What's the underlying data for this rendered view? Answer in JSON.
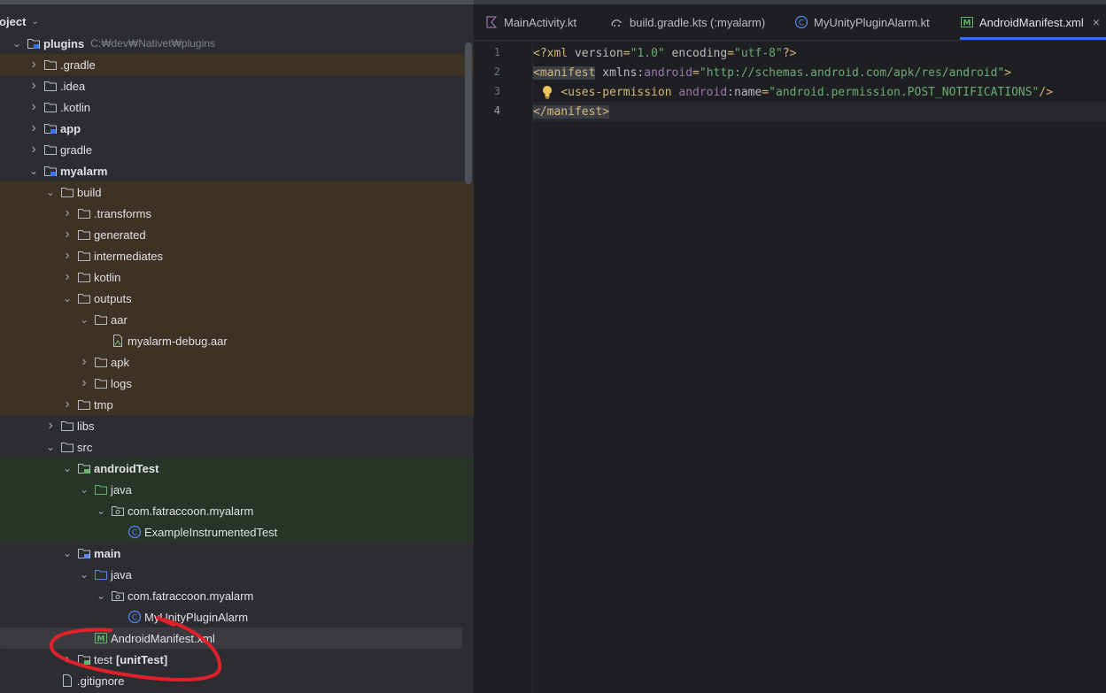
{
  "project_panel": {
    "title": "roject",
    "tree": [
      {
        "label": "plugins",
        "path": "C:₩dev₩Nativet₩plugins",
        "depth": 0,
        "arrow": "down",
        "icon": "module-folder-icon",
        "bold": true,
        "hl": ""
      },
      {
        "label": ".gradle",
        "depth": 1,
        "arrow": "right",
        "icon": "folder-icon",
        "hl": "brown"
      },
      {
        "label": ".idea",
        "depth": 1,
        "arrow": "right",
        "icon": "folder-icon",
        "hl": ""
      },
      {
        "label": ".kotlin",
        "depth": 1,
        "arrow": "right",
        "icon": "folder-icon",
        "hl": ""
      },
      {
        "label": "app",
        "depth": 1,
        "arrow": "right",
        "icon": "module-folder-icon",
        "bold": true,
        "hl": ""
      },
      {
        "label": "gradle",
        "depth": 1,
        "arrow": "right",
        "icon": "folder-icon",
        "hl": ""
      },
      {
        "label": "myalarm",
        "depth": 1,
        "arrow": "down",
        "icon": "module-folder-icon",
        "bold": true,
        "hl": ""
      },
      {
        "label": "build",
        "depth": 2,
        "arrow": "down",
        "icon": "folder-icon",
        "hl": "brown"
      },
      {
        "label": ".transforms",
        "depth": 3,
        "arrow": "right",
        "icon": "folder-icon",
        "hl": "brown"
      },
      {
        "label": "generated",
        "depth": 3,
        "arrow": "right",
        "icon": "folder-icon",
        "hl": "brown"
      },
      {
        "label": "intermediates",
        "depth": 3,
        "arrow": "right",
        "icon": "folder-icon",
        "hl": "brown"
      },
      {
        "label": "kotlin",
        "depth": 3,
        "arrow": "right",
        "icon": "folder-icon",
        "hl": "brown"
      },
      {
        "label": "outputs",
        "depth": 3,
        "arrow": "down",
        "icon": "folder-icon",
        "hl": "brown"
      },
      {
        "label": "aar",
        "depth": 4,
        "arrow": "down",
        "icon": "folder-icon",
        "hl": "brown"
      },
      {
        "label": "myalarm-debug.aar",
        "depth": 5,
        "arrow": "",
        "icon": "aar-file-icon",
        "hl": "brown"
      },
      {
        "label": "apk",
        "depth": 4,
        "arrow": "right",
        "icon": "folder-icon",
        "hl": "brown"
      },
      {
        "label": "logs",
        "depth": 4,
        "arrow": "right",
        "icon": "folder-icon",
        "hl": "brown"
      },
      {
        "label": "tmp",
        "depth": 3,
        "arrow": "right",
        "icon": "folder-icon",
        "hl": "brown"
      },
      {
        "label": "libs",
        "depth": 2,
        "arrow": "right",
        "icon": "folder-icon",
        "hl": ""
      },
      {
        "label": "src",
        "depth": 2,
        "arrow": "down",
        "icon": "folder-icon",
        "hl": ""
      },
      {
        "label": "androidTest",
        "depth": 3,
        "arrow": "down",
        "icon": "test-source-root-icon",
        "bold": true,
        "hl": "green"
      },
      {
        "label": "java",
        "depth": 4,
        "arrow": "down",
        "icon": "green-folder-icon",
        "hl": "green"
      },
      {
        "label": "com.fatraccoon.myalarm",
        "depth": 5,
        "arrow": "down",
        "icon": "package-icon",
        "hl": "green"
      },
      {
        "label": "ExampleInstrumentedTest",
        "depth": 6,
        "arrow": "",
        "icon": "class-icon",
        "hl": "green"
      },
      {
        "label": "main",
        "depth": 3,
        "arrow": "down",
        "icon": "source-root-icon",
        "bold": true,
        "hl": ""
      },
      {
        "label": "java",
        "depth": 4,
        "arrow": "down",
        "icon": "blue-folder-icon",
        "hl": ""
      },
      {
        "label": "com.fatraccoon.myalarm",
        "depth": 5,
        "arrow": "down",
        "icon": "package-icon",
        "hl": ""
      },
      {
        "label": "MyUnityPluginAlarm",
        "depth": 6,
        "arrow": "",
        "icon": "class-icon",
        "hl": ""
      },
      {
        "label": "AndroidManifest.xml",
        "depth": 4,
        "arrow": "",
        "icon": "manifest-icon",
        "hl": "",
        "selected": true
      },
      {
        "label": "test",
        "suffix": "[unitTest]",
        "depth": 3,
        "arrow": "right",
        "icon": "test-source-root-icon",
        "hl": ""
      },
      {
        "label": ".gitignore",
        "depth": 2,
        "arrow": "",
        "icon": "file-icon",
        "hl": ""
      }
    ]
  },
  "tabs": [
    {
      "label": "MainActivity.kt",
      "icon": "kotlin-file-icon"
    },
    {
      "label": "build.gradle.kts (:myalarm)",
      "icon": "gradle-icon"
    },
    {
      "label": "MyUnityPluginAlarm.kt",
      "icon": "kotlin-class-icon"
    },
    {
      "label": "AndroidManifest.xml",
      "icon": "manifest-icon",
      "active": true,
      "close": "×"
    }
  ],
  "editor": {
    "lines": [
      {
        "num": "1",
        "segments": [
          [
            "pun",
            "<?"
          ],
          [
            "tag",
            "xml "
          ],
          [
            "attr",
            "version"
          ],
          [
            "pun",
            "="
          ],
          [
            "str",
            "\"1.0\""
          ],
          [
            "attr",
            " encoding"
          ],
          [
            "pun",
            "="
          ],
          [
            "str",
            "\"utf-8\""
          ],
          [
            "pun",
            "?>"
          ]
        ]
      },
      {
        "num": "2",
        "segments": [
          [
            "tagh",
            "<manifest"
          ],
          [
            "attr",
            " xmlns:"
          ],
          [
            "ns",
            "android"
          ],
          [
            "pun",
            "="
          ],
          [
            "str",
            "\"http://schemas.android.com/apk/res/android\""
          ],
          [
            "pun",
            ">"
          ]
        ]
      },
      {
        "num": "3",
        "segments": [
          [
            "attr",
            "    "
          ],
          [
            "tag",
            "<uses-permission "
          ],
          [
            "ns",
            "android"
          ],
          [
            "attr",
            ":name"
          ],
          [
            "pun",
            "="
          ],
          [
            "str",
            "\"android.permission.POST_NOTIFICATIONS\""
          ],
          [
            "pun",
            "/>"
          ]
        ],
        "bulb": true
      },
      {
        "num": "4",
        "segments": [
          [
            "tagh",
            "</manifest>"
          ]
        ],
        "current": true
      }
    ]
  },
  "colors": {
    "annotation": "#e0202a",
    "tab_accent": "#3574f0"
  }
}
